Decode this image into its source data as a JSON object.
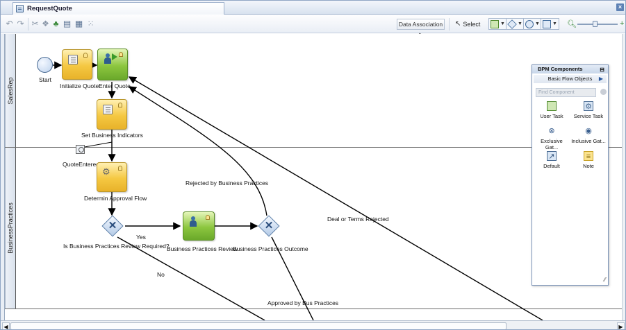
{
  "editor_tab": {
    "title": "RequestQuote"
  },
  "toolbar": {
    "data_association": "Data Association",
    "select_label": "Select"
  },
  "lanes": [
    {
      "name": "SalesRep"
    },
    {
      "name": "BusinessPractices"
    }
  ],
  "nodes": {
    "start": "Start",
    "initialize_quote": "Initialize Quote",
    "enter_quote": "Enter Quote",
    "set_business_indicators": "Set Business Indicators",
    "quote_entered": "QuoteEntered",
    "determine_approval_flow": "Determin Approval Flow",
    "review_required_gateway": "Is Business Practices Review Required?",
    "business_practices_review": "Business Practices Review",
    "business_practices_outcome": "Business Practices Outcome"
  },
  "flows": {
    "yes": "Yes",
    "no": "No",
    "rejected_by_bp": "Rejected by Business Practices",
    "deal_rejected": "Deal or Terms Rejected",
    "approved_by_bp": "Approved by Bus Practices"
  },
  "palette": {
    "title": "BPM Components",
    "section": "Basic Flow Objects",
    "search_placeholder": "Find Component",
    "items": [
      {
        "label": "User Task",
        "icon": "user-task-icon"
      },
      {
        "label": "Service Task",
        "icon": "service-task-icon"
      },
      {
        "label": "Exclusive Gat...",
        "icon": "exclusive-gateway-icon"
      },
      {
        "label": "Inclusive Gat...",
        "icon": "inclusive-gateway-icon"
      },
      {
        "label": "Default",
        "icon": "default-flow-icon"
      },
      {
        "label": "Note",
        "icon": "note-icon"
      }
    ]
  },
  "colors": {
    "task_yellow": "#f5c842",
    "task_green": "#8cc63f",
    "gateway_blue": "#b4cbe7",
    "frame_blue": "#7c95ba"
  }
}
